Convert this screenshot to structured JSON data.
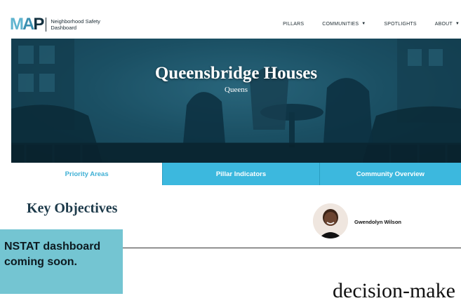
{
  "header": {
    "logo_text": "MAP",
    "logo_subtitle": "Neighborhood Safety Dashboard",
    "nav": [
      {
        "label": "PILLARS",
        "dropdown": false
      },
      {
        "label": "COMMUNITIES",
        "dropdown": true
      },
      {
        "label": "SPOTLIGHTS",
        "dropdown": false
      },
      {
        "label": "ABOUT",
        "dropdown": true
      }
    ]
  },
  "hero": {
    "title": "Queensbridge Houses",
    "subtitle": "Queens"
  },
  "tabs": [
    {
      "label": "Priority Areas",
      "active": true
    },
    {
      "label": "Pillar Indicators",
      "active": false
    },
    {
      "label": "Community Overview",
      "active": false
    }
  ],
  "main": {
    "section_title": "Key Objectives",
    "author_name": "Gwendolyn Wilson",
    "notice": "NSTAT dashboard coming soon.",
    "partial_text": "decision-make"
  },
  "colors": {
    "accent": "#3cb8de",
    "notice_bg": "#74c5d2",
    "hero_tint": "#1b4f63"
  }
}
